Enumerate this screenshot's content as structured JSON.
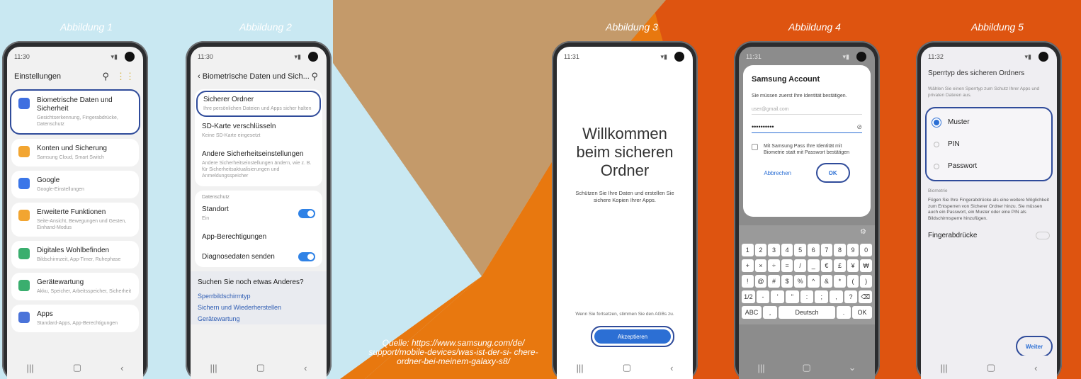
{
  "captions": {
    "c1": "Abbildung 1",
    "c2": "Abbildung 2",
    "c3": "Abbildung 3",
    "c4": "Abbildung 4",
    "c5": "Abbildung 5"
  },
  "source": "Quelle: https://www.samsung.com/de/ support/mobile-devices/was-ist-der-si- chere-ordner-bei-meinem-galaxy-s8/",
  "colors": {
    "light_blue": "#c9e8f2",
    "tan": "#c49a6a",
    "orange": "#e8780f",
    "dark_orange": "#de5410",
    "highlight": "#2f4b9a",
    "toggle": "#2f82e6"
  },
  "p1": {
    "time": "11:30",
    "title": "Einstellungen",
    "items": [
      {
        "t": "Biometrische Daten und Sicherheit",
        "s": "Gesichtserkennung, Fingerabdrücke, Datenschutz",
        "icon": "shield-icon",
        "color": "#3f6fe0"
      },
      {
        "t": "Konten und Sicherung",
        "s": "Samsung Cloud, Smart Switch",
        "icon": "key-icon",
        "color": "#f2a531"
      },
      {
        "t": "Google",
        "s": "Google-Einstellungen",
        "icon": "google-icon",
        "color": "#3b76e8"
      },
      {
        "t": "Erweiterte Funktionen",
        "s": "Seite-Ansicht, Bewegungen und Gesten, Einhand-Modus",
        "icon": "plus-gear-icon",
        "color": "#f2a531"
      },
      {
        "t": "Digitales Wohlbefinden",
        "s": "Bildschirmzeit, App-Timer, Ruhephase",
        "icon": "wellbeing-icon",
        "color": "#3aae6e"
      },
      {
        "t": "Gerätewartung",
        "s": "Akku, Speicher, Arbeitsspeicher, Sicherheit",
        "icon": "maintenance-icon",
        "color": "#3aae6e"
      },
      {
        "t": "Apps",
        "s": "Standard-Apps, App-Berechtigungen",
        "icon": "apps-icon",
        "color": "#4a73d9"
      }
    ]
  },
  "p2": {
    "time": "11:30",
    "title": "Biometrische Daten und Sich...",
    "secure": {
      "t": "Sicherer Ordner",
      "s": "Ihre persönlichen Dateien und Apps sicher halten"
    },
    "sd": {
      "t": "SD-Karte verschlüsseln",
      "s": "Keine SD-Karte eingesetzt"
    },
    "other": {
      "t": "Andere Sicherheitseinstellungen",
      "s": "Andere Sicherheitseinstellungen ändern, wie z. B. für Sicherheitsaktualisierungen und Anmeldungsspeicher"
    },
    "section": "Datenschutz",
    "location": {
      "t": "Standort",
      "s": "Ein"
    },
    "perm": "App-Berechtigungen",
    "diag": "Diagnosedaten senden",
    "more": "Suchen Sie noch etwas Anderes?",
    "links": [
      "Sperrbildschirmtyp",
      "Sichern und Wiederherstellen",
      "Gerätewartung"
    ]
  },
  "p3": {
    "time": "11:31",
    "welcome": "Willkommen beim sicheren Ordner",
    "desc": "Schützen Sie Ihre Daten und erstellen Sie sichere Kopien Ihrer Apps.",
    "terms": "Wenn Sie fortsetzen, stimmen Sie den AGBs zu.",
    "accept": "Akzeptieren"
  },
  "p4": {
    "time": "11:31",
    "title": "Samsung Account",
    "desc": "Sie müssen zuerst Ihre Identität bestätigen.",
    "email": "user@gmail.com",
    "password": "••••••••••",
    "check": "Mit Samsung Pass Ihre Identität mit Biometrie statt mit Passwort bestätigen",
    "cancel": "Abbrechen",
    "ok": "OK",
    "rows": [
      [
        "1",
        "2",
        "3",
        "4",
        "5",
        "6",
        "7",
        "8",
        "9",
        "0"
      ],
      [
        "+",
        "×",
        "÷",
        "=",
        "/",
        "_",
        "€",
        "£",
        "¥",
        "₩"
      ],
      [
        "!",
        "@",
        "#",
        "$",
        "%",
        "^",
        "&",
        "*",
        "(",
        ")"
      ]
    ],
    "row4": [
      "1/2",
      "-",
      "'",
      "\"",
      ":",
      ";",
      ",",
      "?",
      "⌫"
    ],
    "row5": [
      "ABC",
      ",",
      "Deutsch",
      ".",
      "OK"
    ]
  },
  "p5": {
    "time": "11:32",
    "title": "Sperrtyp des sicheren Ordners",
    "desc": "Wählen Sie einen Sperrtyp zum Schutz Ihrer Apps und privaten Dateien aus.",
    "options": [
      "Muster",
      "PIN",
      "Passwort"
    ],
    "section": "Biometrie",
    "bio": "Fügen Sie Ihre Fingerabdrücke als eine weitere Möglichkeit zum Entsperren von Sicherer Ordner hinzu. Sie müssen auch ein Passwort, ein Muster oder eine PIN als Bildschirmsperre hinzufügen.",
    "finger": "Fingerabdrücke",
    "next": "Weiter"
  }
}
